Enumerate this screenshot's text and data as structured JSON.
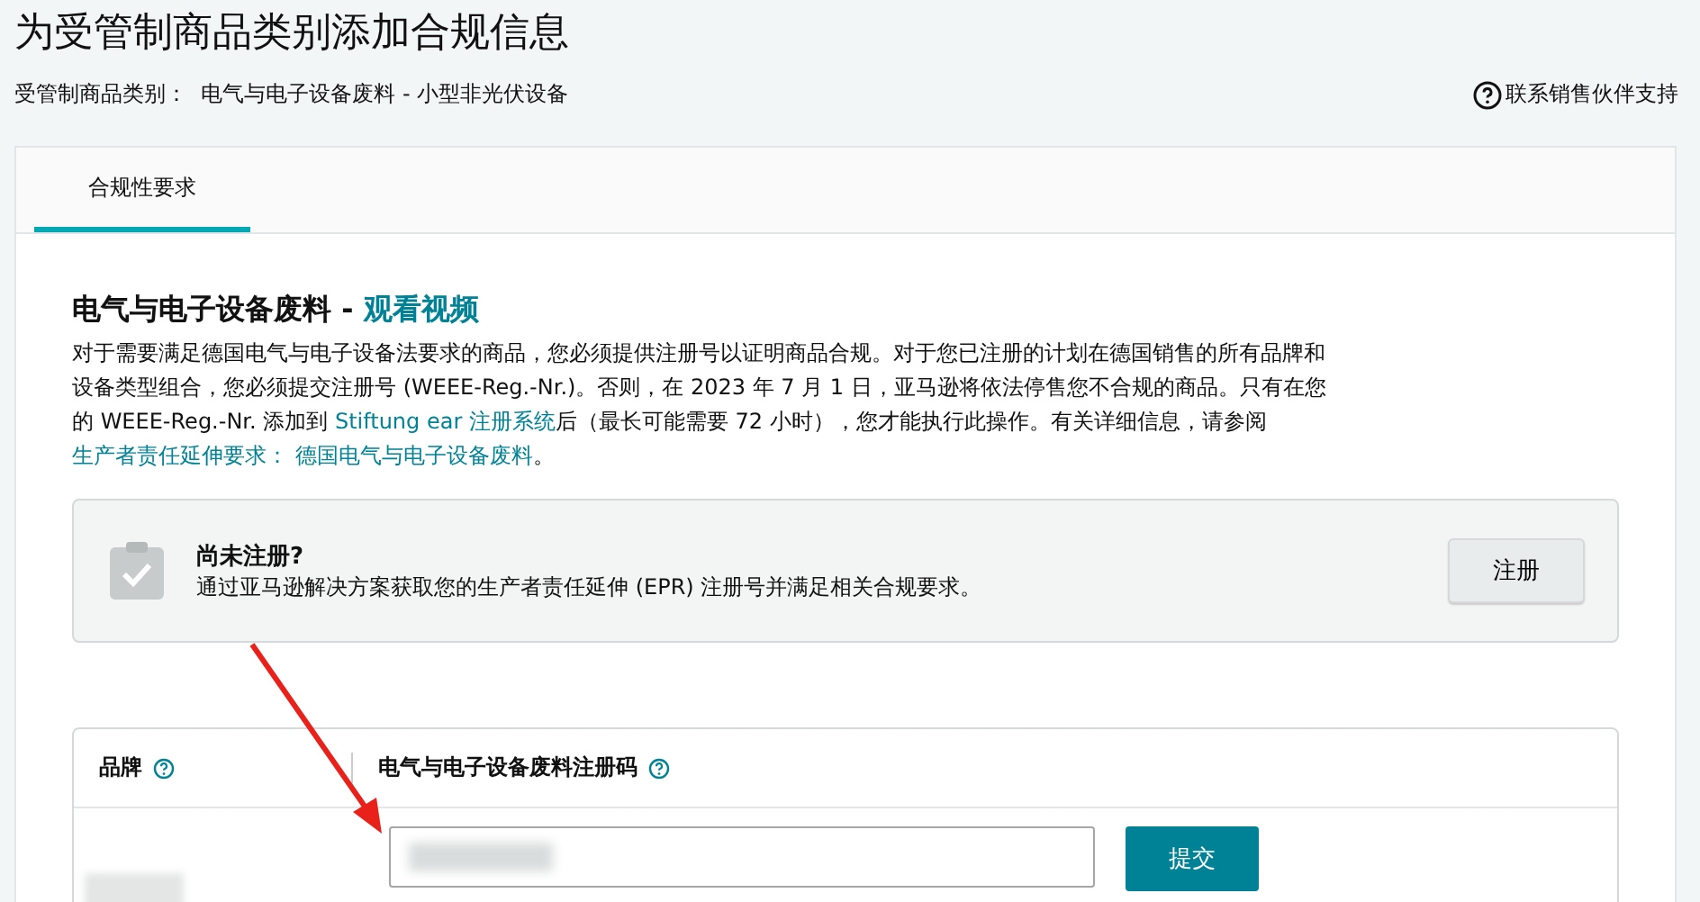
{
  "page": {
    "title": "为受管制商品类别添加合规信息",
    "category": "受管制商品类别：  电气与电子设备废料 - 小型非光伏设备",
    "support_link": "联系销售伙伴支持"
  },
  "tabs": [
    {
      "label": "合规性要求",
      "selected": true
    }
  ],
  "section": {
    "title": "电气与电子设备废料 - ",
    "video_link": "观看视频",
    "paragraph": [
      {
        "kind": "text",
        "text": "对于需要满足德国电气与电子设备法要求的商品，您必须提供注册号以证明商品合规。对于您已注册的计划在德国销售的所有品牌和设备类型组合，您必须提交注册号 (WEEE-Reg.-Nr.)。否则，在 2023 年 7 月 1 日，亚马逊将依法停售您不合规的商品。只有在您的 WEEE-Reg.-Nr. 添加到 "
      },
      {
        "kind": "link",
        "text": "Stiftung ear 注册系统"
      },
      {
        "kind": "text",
        "text": "后（最长可能需要 72 小时），您才能执行此操作。有关详细信息，请参阅"
      },
      {
        "kind": "link",
        "text": "生产者责任延伸要求： 德国电气与电子设备废料"
      },
      {
        "kind": "text",
        "text": "。"
      }
    ]
  },
  "notice": {
    "title": "尚未注册?",
    "text": "通过亚马逊解决方案获取您的生产者责任延伸 (EPR) 注册号并满足相关合规要求。",
    "button": "注册"
  },
  "table": {
    "columns": [
      "品牌",
      "电气与电子设备废料注册码"
    ],
    "rows": [
      {
        "submit": "提交"
      }
    ]
  }
}
